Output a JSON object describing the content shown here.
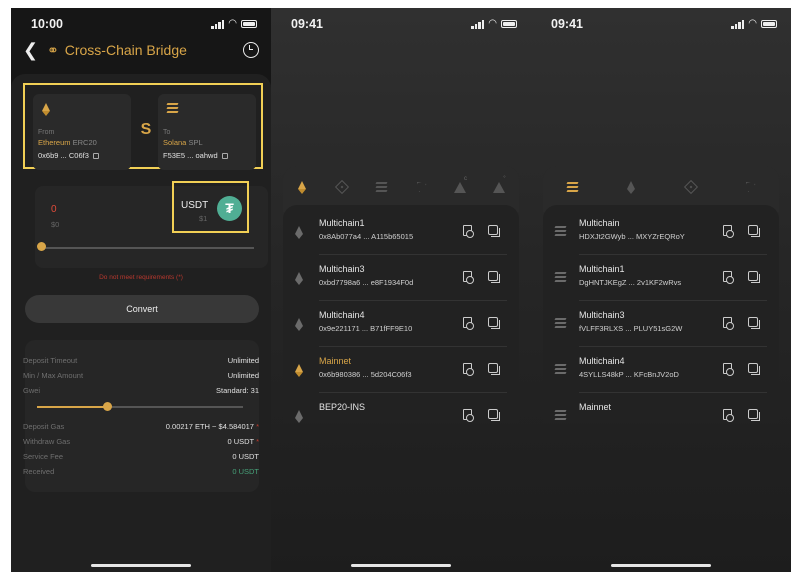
{
  "screen1": {
    "status_time": "10:00",
    "nav": {
      "title": "Cross-Chain Bridge"
    },
    "from": {
      "direction": "From",
      "network": "Ethereum",
      "standard": "ERC20",
      "address": "0x6b9 ... C06f3"
    },
    "to": {
      "direction": "To",
      "network": "Solana",
      "standard": "SPL",
      "address": "F53E5 ... oahwd"
    },
    "amount": {
      "value": "0",
      "usd": "$0"
    },
    "token": {
      "symbol": "USDT",
      "usd": "$1"
    },
    "warning": "Do not meet requirements (*)",
    "convert_label": "Convert",
    "params": [
      {
        "label": "Deposit Timeout",
        "value": "Unlimited"
      },
      {
        "label": "Min / Max Amount",
        "value": "Unlimited"
      },
      {
        "label": "Gwei",
        "value": "Standard: 31"
      }
    ],
    "gwei_slider_level": 0.34,
    "fees": [
      {
        "label": "Deposit Gas",
        "value": "0.00217 ETH ~ $4.584017",
        "star": "*"
      },
      {
        "label": "Withdraw Gas",
        "value": "0 USDT",
        "star": "*"
      },
      {
        "label": "Service Fee",
        "value": "0 USDT",
        "star": ""
      },
      {
        "label": "Received",
        "value": "0 USDT",
        "star": ""
      }
    ]
  },
  "screen2": {
    "status_time": "09:41",
    "tabs": [
      "ethereum-icon",
      "bnb-icon",
      "solana-icon",
      "tron-icon",
      "avalanche-c-icon",
      "avalanche-icon"
    ],
    "rows": [
      {
        "name": "Multichain1",
        "address": "0x8Ab077a4 ... A115b65015"
      },
      {
        "name": "Multichain3",
        "address": "0xbd7798a6 ... e8F1934F0d"
      },
      {
        "name": "Multichain4",
        "address": "0x9e221171 ... B71fFF9E10"
      },
      {
        "name": "Mainnet",
        "address": "0x6b980386 ... 5d204C06f3"
      },
      {
        "name": "BEP20-INS",
        "address": ""
      }
    ]
  },
  "screen3": {
    "status_time": "09:41",
    "tabs": [
      "solana-icon",
      "ethereum-icon",
      "bnb-icon",
      "tron-icon"
    ],
    "rows": [
      {
        "name": "Multichain",
        "address": "HDXJt2GWyb ... MXYZrEQRoY"
      },
      {
        "name": "Multichain1",
        "address": "DgHNTJKEgZ ... 2v1KF2wRvs"
      },
      {
        "name": "Multichain3",
        "address": "fVLFF3RLXS ... PLUY51sG2W"
      },
      {
        "name": "Multichain4",
        "address": "4SYLLS48kP ... KFcBnJV2oD"
      },
      {
        "name": "Mainnet",
        "address": ""
      }
    ]
  },
  "colors": {
    "accent": "#d8a548",
    "error": "#e04b3a",
    "success": "#46a078",
    "tether": "#50ae94"
  }
}
